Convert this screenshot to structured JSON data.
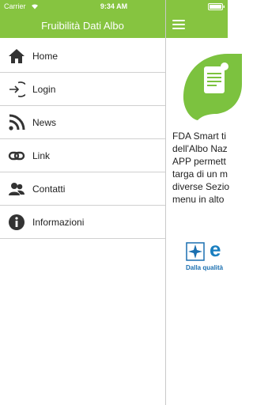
{
  "status_bar": {
    "carrier": "Carrier",
    "time": "9:34 AM"
  },
  "drawer": {
    "title": "Fruibilità Dati Albo",
    "items": [
      {
        "label": "Home",
        "icon": "home-icon"
      },
      {
        "label": "Login",
        "icon": "login-icon"
      },
      {
        "label": "News",
        "icon": "rss-icon"
      },
      {
        "label": "Link",
        "icon": "link-icon"
      },
      {
        "label": "Contatti",
        "icon": "contacts-icon"
      },
      {
        "label": "Informazioni",
        "icon": "info-icon"
      }
    ]
  },
  "main": {
    "description_lines": [
      "FDA Smart ti",
      "dell'Albo Naz",
      "APP permett",
      "targa di un m",
      "diverse Sezio",
      "menu in alto"
    ],
    "brand": {
      "wordmark": "e",
      "tagline": "Dalla qualità"
    }
  },
  "colors": {
    "header_green": "#86c440",
    "leaf_green": "#7cc23f",
    "brand_blue": "#1a7fc0"
  }
}
